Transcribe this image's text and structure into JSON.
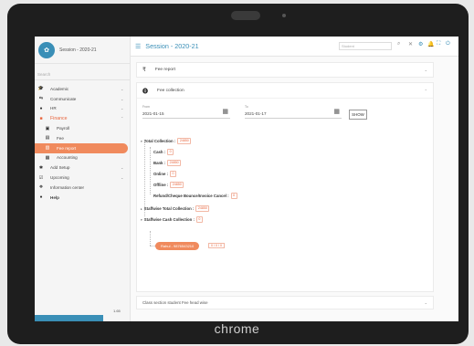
{
  "device": {
    "label": "chrome"
  },
  "sidebar": {
    "brand": "Session - 2020-21",
    "search_placeholder": "Search",
    "version": "1.65",
    "items": [
      {
        "label": "Academic",
        "icon": "graduation-cap-icon"
      },
      {
        "label": "Communicate",
        "icon": "chat-icon"
      },
      {
        "label": "HR",
        "icon": "person-icon"
      },
      {
        "label": "Finance",
        "icon": "briefcase-icon"
      },
      {
        "label": "Payroll",
        "icon": "payroll-icon"
      },
      {
        "label": "Fee",
        "icon": "fee-icon"
      },
      {
        "label": "Fee report",
        "icon": "report-icon"
      },
      {
        "label": "Accounting",
        "icon": "accounting-icon"
      },
      {
        "label": "Add Setup",
        "icon": "gear-icon"
      },
      {
        "label": "Upcoming",
        "icon": "edit-icon"
      },
      {
        "label": "Information center",
        "icon": "hierarchy-icon"
      },
      {
        "label": "Help",
        "icon": "help-icon"
      }
    ]
  },
  "topbar": {
    "title": "Session - 2020-21",
    "student_placeholder": "Student"
  },
  "panels": {
    "fee_report": "Fee report",
    "fee_collection": "Fee collection",
    "from": {
      "label": "From",
      "value": "2021-01-15"
    },
    "to": {
      "label": "To",
      "value": "2021-01-17"
    },
    "show_button": "SHOW",
    "tree": {
      "total": {
        "label": "Total Collection :",
        "value": "24850"
      },
      "cash": {
        "label": "Cash :",
        "value": "0"
      },
      "bank": {
        "label": "Bank :",
        "value": "24850"
      },
      "online": {
        "label": "Online :",
        "value": "0"
      },
      "offline": {
        "label": "Offline :",
        "value": "24850"
      },
      "refund": {
        "label": "Refund/Cheque Bounce/Invoice Cancel :",
        "value": "0"
      },
      "staff_total": {
        "label": "Staffwise Total Collection :",
        "value": "24850"
      },
      "staff_cash": {
        "label": "Staffwise Cash Collection :",
        "value": "0"
      },
      "staff_pill": "Rahul - 9876543210",
      "staff_pill_value": "0 / 0 / 0"
    },
    "bottom": "Class section student Fee head wise"
  }
}
